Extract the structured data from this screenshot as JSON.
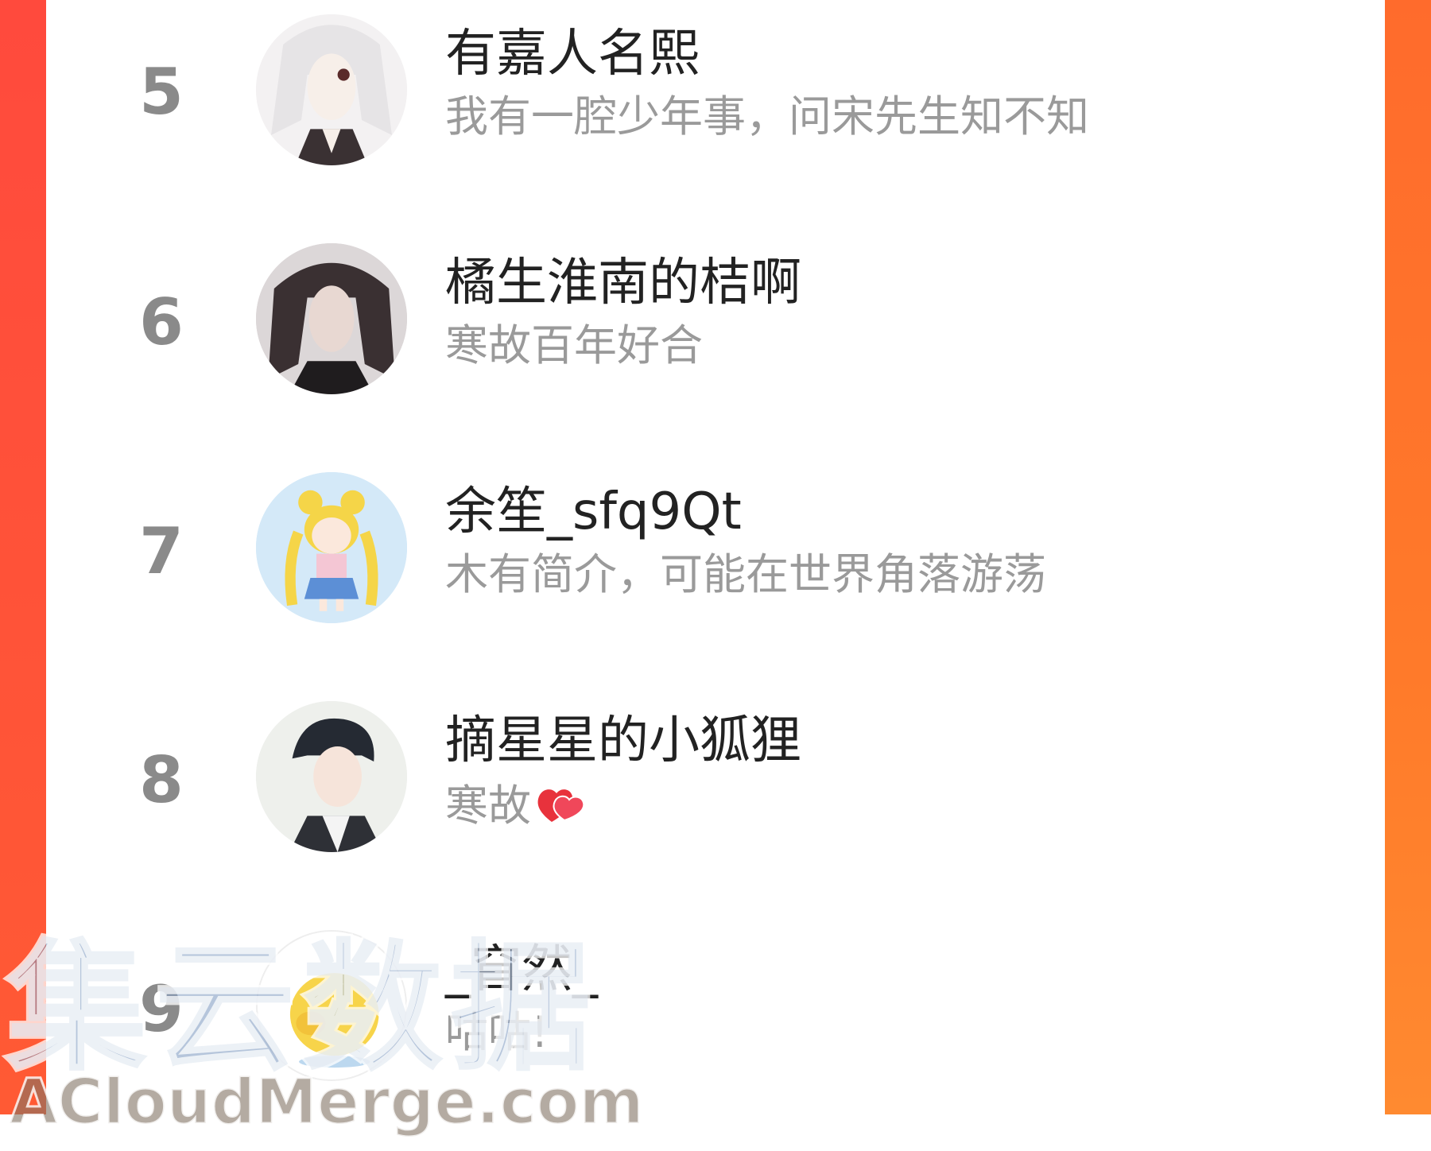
{
  "leaderboard": {
    "entries": [
      {
        "rank": "5",
        "name": "有嘉人名熙",
        "bio": "我有一腔少年事，问宋先生知不知",
        "avatar": "avatar-white-hair-icon"
      },
      {
        "rank": "6",
        "name": "橘生淮南的桔啊",
        "bio": "寒故百年好合",
        "avatar": "avatar-dark-hair-man-icon"
      },
      {
        "rank": "7",
        "name": "余笙_sfq9Qt",
        "bio": "木有简介，可能在世界角落游荡",
        "avatar": "avatar-sailor-moon-icon"
      },
      {
        "rank": "8",
        "name": "摘星星的小狐狸",
        "bio": "寒故",
        "bio_icon": "red-heart-icon",
        "avatar": "avatar-young-man-icon"
      },
      {
        "rank": "9",
        "name": "_窅然_",
        "bio": "咕咕!",
        "avatar": "avatar-yellow-chick-icon"
      }
    ]
  },
  "watermark": {
    "main": "集云数据",
    "sub": "ACloudMerge.com"
  },
  "colors": {
    "frame_left": "#ff4a3d",
    "frame_right": "#ff7a2a",
    "rank": "#8a8a8a",
    "name": "#222222",
    "bio": "#9a9a9a"
  }
}
